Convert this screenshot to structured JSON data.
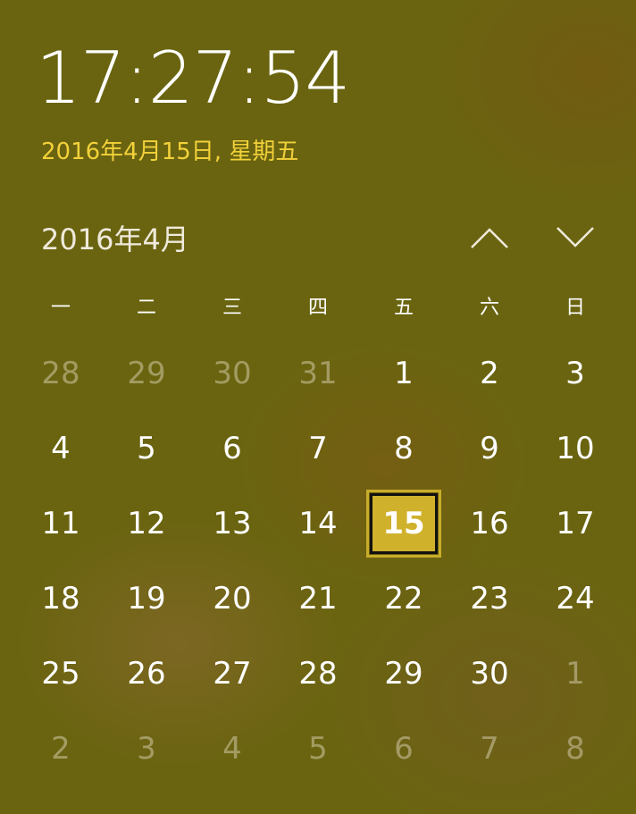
{
  "clock": {
    "time": "17:27:54"
  },
  "date_long": "2016年4月15日, 星期五",
  "calendar": {
    "month_title": "2016年4月",
    "prev_icon": "chevron-up-icon",
    "next_icon": "chevron-down-icon",
    "weekdays": [
      "一",
      "二",
      "三",
      "四",
      "五",
      "六",
      "日"
    ],
    "days": [
      {
        "label": "28",
        "other": true
      },
      {
        "label": "29",
        "other": true
      },
      {
        "label": "30",
        "other": true
      },
      {
        "label": "31",
        "other": true
      },
      {
        "label": "1"
      },
      {
        "label": "2"
      },
      {
        "label": "3"
      },
      {
        "label": "4"
      },
      {
        "label": "5"
      },
      {
        "label": "6"
      },
      {
        "label": "7"
      },
      {
        "label": "8"
      },
      {
        "label": "9"
      },
      {
        "label": "10"
      },
      {
        "label": "11"
      },
      {
        "label": "12"
      },
      {
        "label": "13"
      },
      {
        "label": "14"
      },
      {
        "label": "15",
        "today": true
      },
      {
        "label": "16"
      },
      {
        "label": "17"
      },
      {
        "label": "18"
      },
      {
        "label": "19"
      },
      {
        "label": "20"
      },
      {
        "label": "21"
      },
      {
        "label": "22"
      },
      {
        "label": "23"
      },
      {
        "label": "24"
      },
      {
        "label": "25"
      },
      {
        "label": "26"
      },
      {
        "label": "27"
      },
      {
        "label": "28"
      },
      {
        "label": "29"
      },
      {
        "label": "30"
      },
      {
        "label": "1",
        "other": true
      },
      {
        "label": "2",
        "other": true
      },
      {
        "label": "3",
        "other": true
      },
      {
        "label": "4",
        "other": true
      },
      {
        "label": "5",
        "other": true
      },
      {
        "label": "6",
        "other": true
      },
      {
        "label": "7",
        "other": true
      },
      {
        "label": "8",
        "other": true
      }
    ]
  },
  "colors": {
    "accent": "#cfb12c",
    "date_text": "#f2d13a",
    "background": "#6a6410"
  }
}
